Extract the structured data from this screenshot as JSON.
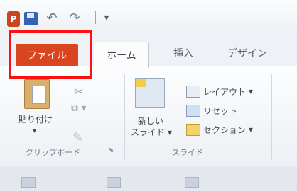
{
  "qat": {
    "app_icon_letter": "P",
    "icons": [
      "powerpoint-icon",
      "save-icon",
      "undo-icon",
      "redo-icon",
      "customize-qat-icon"
    ]
  },
  "tabs": [
    {
      "label": "ファイル",
      "active": false,
      "highlighted": true
    },
    {
      "label": "ホーム",
      "active": true
    },
    {
      "label": "挿入",
      "active": false
    },
    {
      "label": "デザイン",
      "active": false
    }
  ],
  "groups": {
    "clipboard": {
      "label": "クリップボード",
      "paste_label": "貼り付け",
      "icons": [
        "paste-icon",
        "cut-icon",
        "copy-icon",
        "format-painter-icon"
      ]
    },
    "slides": {
      "label": "スライド",
      "new_slide_line1": "新しい",
      "new_slide_line2": "スライド",
      "layout": "レイアウト",
      "reset": "リセット",
      "section": "セクション"
    }
  },
  "colors": {
    "file_tab": "#d9451f",
    "highlight_box": "#ff1010",
    "app_icon": "#c8461e",
    "save_icon": "#3563b3"
  }
}
